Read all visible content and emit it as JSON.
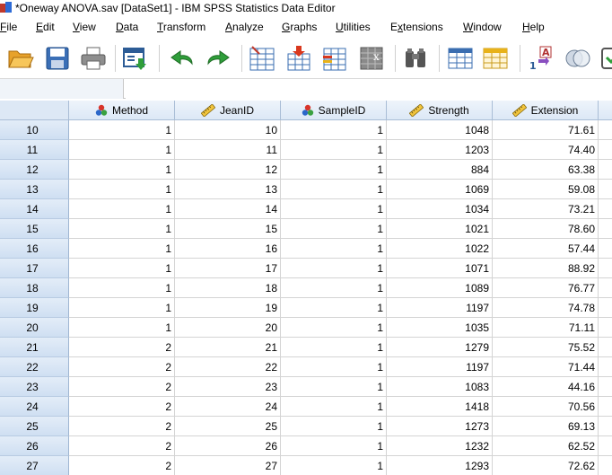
{
  "window": {
    "title": "*Oneway ANOVA.sav [DataSet1] - IBM SPSS Statistics Data Editor"
  },
  "menu": [
    {
      "label": "File",
      "ul": "F"
    },
    {
      "label": "Edit",
      "ul": "E"
    },
    {
      "label": "View",
      "ul": "V"
    },
    {
      "label": "Data",
      "ul": "D"
    },
    {
      "label": "Transform",
      "ul": "T"
    },
    {
      "label": "Analyze",
      "ul": "A"
    },
    {
      "label": "Graphs",
      "ul": "G"
    },
    {
      "label": "Utilities",
      "ul": "U"
    },
    {
      "label": "Extensions",
      "ul": "x"
    },
    {
      "label": "Window",
      "ul": "W"
    },
    {
      "label": "Help",
      "ul": "H"
    }
  ],
  "toolbar": [
    {
      "name": "open-icon"
    },
    {
      "name": "save-icon"
    },
    {
      "name": "print-icon"
    },
    {
      "name": "dialog-recall-icon"
    },
    {
      "name": "undo-icon"
    },
    {
      "name": "redo-icon"
    },
    {
      "name": "go-to-case-icon"
    },
    {
      "name": "insert-cases-icon"
    },
    {
      "name": "insert-variable-icon"
    },
    {
      "name": "split-file-icon"
    },
    {
      "name": "find-icon"
    },
    {
      "name": "value-labels-icon"
    },
    {
      "name": "weight-cases-icon"
    },
    {
      "name": "select-cases-icon"
    },
    {
      "name": "use-sets-icon"
    },
    {
      "name": "show-all-icon"
    }
  ],
  "columns": [
    {
      "label": "Method",
      "icon": "nominal-icon"
    },
    {
      "label": "JeanID",
      "icon": "scale-icon"
    },
    {
      "label": "SampleID",
      "icon": "nominal-icon"
    },
    {
      "label": "Strength",
      "icon": "scale-icon"
    },
    {
      "label": "Extension",
      "icon": "scale-icon"
    }
  ],
  "rows": [
    {
      "id": "10",
      "cells": [
        "1",
        "10",
        "1",
        "1048",
        "71.61"
      ]
    },
    {
      "id": "11",
      "cells": [
        "1",
        "11",
        "1",
        "1203",
        "74.40"
      ]
    },
    {
      "id": "12",
      "cells": [
        "1",
        "12",
        "1",
        "884",
        "63.38"
      ]
    },
    {
      "id": "13",
      "cells": [
        "1",
        "13",
        "1",
        "1069",
        "59.08"
      ]
    },
    {
      "id": "14",
      "cells": [
        "1",
        "14",
        "1",
        "1034",
        "73.21"
      ]
    },
    {
      "id": "15",
      "cells": [
        "1",
        "15",
        "1",
        "1021",
        "78.60"
      ]
    },
    {
      "id": "16",
      "cells": [
        "1",
        "16",
        "1",
        "1022",
        "57.44"
      ]
    },
    {
      "id": "17",
      "cells": [
        "1",
        "17",
        "1",
        "1071",
        "88.92"
      ]
    },
    {
      "id": "18",
      "cells": [
        "1",
        "18",
        "1",
        "1089",
        "76.77"
      ]
    },
    {
      "id": "19",
      "cells": [
        "1",
        "19",
        "1",
        "1197",
        "74.78"
      ]
    },
    {
      "id": "20",
      "cells": [
        "1",
        "20",
        "1",
        "1035",
        "71.11"
      ]
    },
    {
      "id": "21",
      "cells": [
        "2",
        "21",
        "1",
        "1279",
        "75.52"
      ]
    },
    {
      "id": "22",
      "cells": [
        "2",
        "22",
        "1",
        "1197",
        "71.44"
      ]
    },
    {
      "id": "23",
      "cells": [
        "2",
        "23",
        "1",
        "1083",
        "44.16"
      ]
    },
    {
      "id": "24",
      "cells": [
        "2",
        "24",
        "1",
        "1418",
        "70.56"
      ]
    },
    {
      "id": "25",
      "cells": [
        "2",
        "25",
        "1",
        "1273",
        "69.13"
      ]
    },
    {
      "id": "26",
      "cells": [
        "2",
        "26",
        "1",
        "1232",
        "62.52"
      ]
    },
    {
      "id": "27",
      "cells": [
        "2",
        "27",
        "1",
        "1293",
        "72.62"
      ]
    }
  ]
}
